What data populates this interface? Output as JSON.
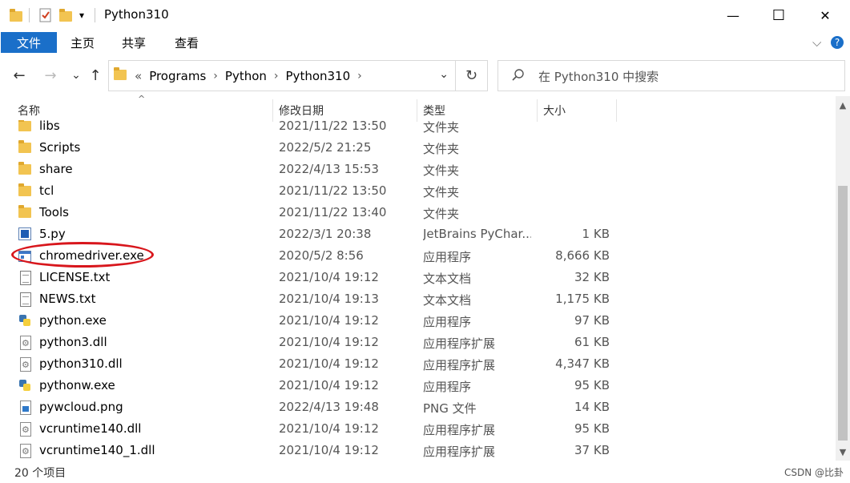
{
  "window": {
    "title": "Python310",
    "qat_dropdown": "▾",
    "minimize": "—",
    "maximize": "☐",
    "close": "✕"
  },
  "ribbon": {
    "tabs": [
      "文件",
      "主页",
      "共享",
      "查看"
    ],
    "expand": "⌵",
    "help": "?"
  },
  "nav": {
    "back": "←",
    "forward": "→",
    "recent": "⌄",
    "up": "↑"
  },
  "address": {
    "overflow": "«",
    "crumbs": [
      "Programs",
      "Python",
      "Python310"
    ],
    "sep": "›",
    "dropdown": "⌄",
    "refresh": "↻"
  },
  "search": {
    "placeholder": "在 Python310 中搜索"
  },
  "columns": {
    "name": "名称",
    "date": "修改日期",
    "type": "类型",
    "size": "大小",
    "sort_indicator": "^"
  },
  "files": [
    {
      "name": "libs",
      "date": "2021/11/22 13:50",
      "type": "文件夹",
      "size": "",
      "icon": "folder-icon"
    },
    {
      "name": "Scripts",
      "date": "2022/5/2 21:25",
      "type": "文件夹",
      "size": "",
      "icon": "folder-icon"
    },
    {
      "name": "share",
      "date": "2022/4/13 15:53",
      "type": "文件夹",
      "size": "",
      "icon": "folder-icon"
    },
    {
      "name": "tcl",
      "date": "2021/11/22 13:50",
      "type": "文件夹",
      "size": "",
      "icon": "folder-icon"
    },
    {
      "name": "Tools",
      "date": "2021/11/22 13:40",
      "type": "文件夹",
      "size": "",
      "icon": "folder-icon"
    },
    {
      "name": "5.py",
      "date": "2022/3/1 20:38",
      "type": "JetBrains PyChar...",
      "size": "1 KB",
      "icon": "pycharm-file-icon"
    },
    {
      "name": "chromedriver.exe",
      "date": "2020/5/2 8:56",
      "type": "应用程序",
      "size": "8,666 KB",
      "icon": "exe-icon"
    },
    {
      "name": "LICENSE.txt",
      "date": "2021/10/4 19:12",
      "type": "文本文档",
      "size": "32 KB",
      "icon": "text-file-icon"
    },
    {
      "name": "NEWS.txt",
      "date": "2021/10/4 19:13",
      "type": "文本文档",
      "size": "1,175 KB",
      "icon": "text-file-icon"
    },
    {
      "name": "python.exe",
      "date": "2021/10/4 19:12",
      "type": "应用程序",
      "size": "97 KB",
      "icon": "python-icon"
    },
    {
      "name": "python3.dll",
      "date": "2021/10/4 19:12",
      "type": "应用程序扩展",
      "size": "61 KB",
      "icon": "dll-icon"
    },
    {
      "name": "python310.dll",
      "date": "2021/10/4 19:12",
      "type": "应用程序扩展",
      "size": "4,347 KB",
      "icon": "dll-icon"
    },
    {
      "name": "pythonw.exe",
      "date": "2021/10/4 19:12",
      "type": "应用程序",
      "size": "95 KB",
      "icon": "python-icon"
    },
    {
      "name": "pywcloud.png",
      "date": "2022/4/13 19:48",
      "type": "PNG 文件",
      "size": "14 KB",
      "icon": "png-icon"
    },
    {
      "name": "vcruntime140.dll",
      "date": "2021/10/4 19:12",
      "type": "应用程序扩展",
      "size": "95 KB",
      "icon": "dll-icon"
    },
    {
      "name": "vcruntime140_1.dll",
      "date": "2021/10/4 19:12",
      "type": "应用程序扩展",
      "size": "37 KB",
      "icon": "dll-icon"
    }
  ],
  "scrollbar": {
    "up": "▲",
    "down": "▼"
  },
  "status": {
    "item_count": "20 个项目",
    "watermark": "CSDN @比卦"
  },
  "colors": {
    "file_tab": "#1a6fc9",
    "annotation": "#d8161c",
    "folder": "#f2c451"
  }
}
